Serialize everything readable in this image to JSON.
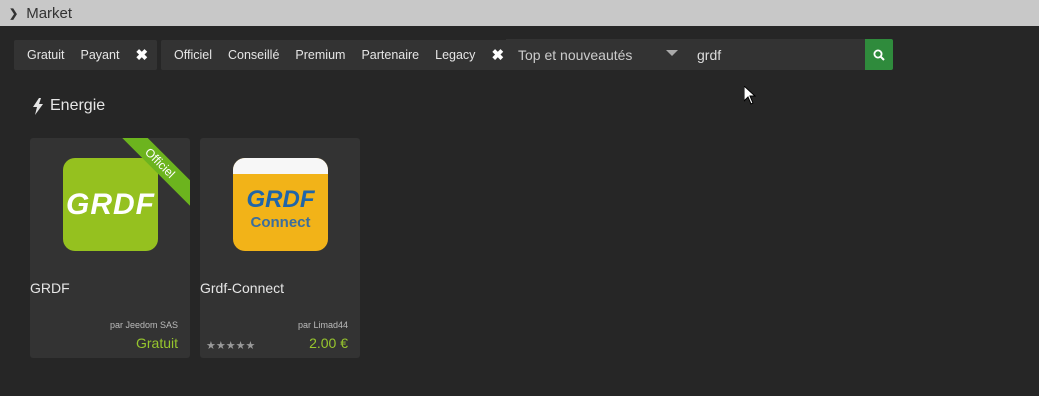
{
  "title": "Market",
  "filters": {
    "price_group": [
      "Gratuit",
      "Payant"
    ],
    "type_group": [
      "Officiel",
      "Conseillé",
      "Premium",
      "Partenaire",
      "Legacy"
    ],
    "clear_icon": "times-icon"
  },
  "sort": {
    "selected": "Top et nouveautés"
  },
  "search": {
    "value": "grdf",
    "button_icon": "search-icon"
  },
  "section": {
    "title": "Energie",
    "icon": "bolt-icon"
  },
  "cards": [
    {
      "logo_text": "GRDF",
      "ribbon": "Officiel",
      "name": "GRDF",
      "author": "par Jeedom SAS",
      "price": "Gratuit",
      "logo_color": "#95c11f"
    },
    {
      "logo_text": "GRDF",
      "logo_sub": "Connect",
      "name": "Grdf-Connect",
      "author": "par Limad44",
      "price": "2.00 €",
      "rating": 0,
      "logo_color": "#f2b318"
    }
  ],
  "colors": {
    "accent_green": "#97c62d",
    "search_button": "#2f8b3c",
    "ribbon": "#6cb41e"
  }
}
